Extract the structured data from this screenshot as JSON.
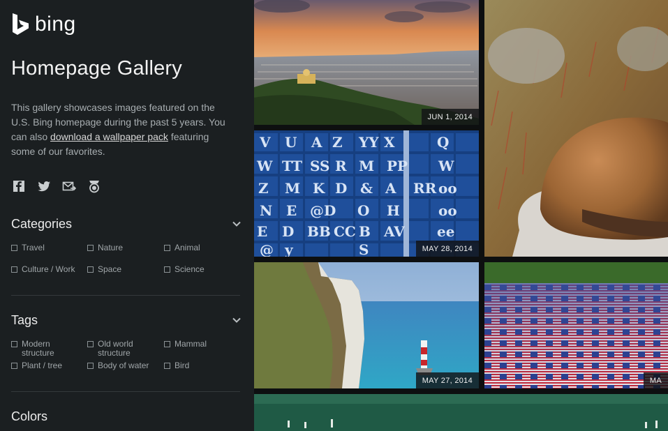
{
  "brand": {
    "name": "bing"
  },
  "page": {
    "title": "Homepage Gallery"
  },
  "description": {
    "text_before": "This gallery showcases images featured on the U.S. Bing homepage during the past 5 years. You can also ",
    "link_label": "download a wallpaper pack",
    "text_after": " featuring some of our favorites."
  },
  "share": {
    "icons": [
      "facebook-icon",
      "twitter-icon",
      "email-icon",
      "medal-icon"
    ]
  },
  "categories": {
    "title": "Categories",
    "items": [
      {
        "label": "Travel"
      },
      {
        "label": "Nature"
      },
      {
        "label": "Animal"
      },
      {
        "label": "Culture / Work"
      },
      {
        "label": "Space"
      },
      {
        "label": "Science"
      }
    ]
  },
  "tags": {
    "title": "Tags",
    "items": [
      {
        "label": "Modern structure"
      },
      {
        "label": "Old world structure"
      },
      {
        "label": "Mammal"
      },
      {
        "label": "Plant / tree"
      },
      {
        "label": "Body of water"
      },
      {
        "label": "Bird"
      }
    ]
  },
  "colors": {
    "title": "Colors"
  },
  "gallery": {
    "tiles": [
      {
        "date": "JUN 1, 2014"
      },
      {
        "date": "MAY 28, 2014"
      },
      {
        "date": "MAY 27, 2014"
      },
      {
        "date": "MA"
      }
    ]
  },
  "theme": {
    "sidebar_bg": "#1b1f21",
    "page_bg": "#0d0f10",
    "text_primary": "#f2f2f2",
    "text_secondary": "#a7adb0"
  }
}
